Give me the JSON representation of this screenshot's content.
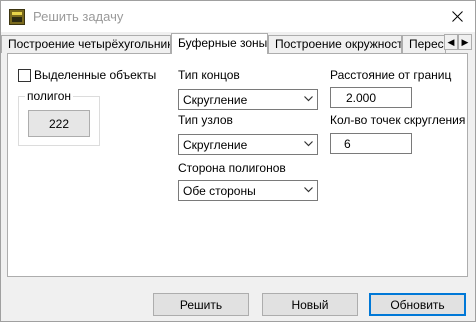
{
  "window": {
    "title": "Решить задачу",
    "close_icon": "close-icon",
    "app_icon": "app-icon"
  },
  "tabs": [
    {
      "label": "Построение четырёхугольника",
      "active": false
    },
    {
      "label": "Буферные зоны",
      "active": true
    },
    {
      "label": "Построение окружности",
      "active": false
    },
    {
      "label": "Перес",
      "active": false
    }
  ],
  "tab_scroll": {
    "left_icon": "chevron-left-icon",
    "right_icon": "chevron-right-icon"
  },
  "panel": {
    "selected_objects_checkbox": {
      "label": "Выделенные объекты",
      "checked": false
    },
    "polygon_group": {
      "legend": "полигон",
      "button_label": "222"
    },
    "end_type": {
      "label": "Тип концов",
      "value": "Скругление"
    },
    "node_type": {
      "label": "Тип узлов",
      "value": "Скругление"
    },
    "polygon_side": {
      "label": "Сторона полигонов",
      "value": "Обе стороны"
    },
    "distance": {
      "label": "Расстояние от границ",
      "value": "2.000"
    },
    "rounding_points": {
      "label": "Кол-во точек скругления",
      "value": "6"
    }
  },
  "buttons": {
    "solve": "Решить",
    "new": "Новый",
    "refresh": "Обновить"
  }
}
